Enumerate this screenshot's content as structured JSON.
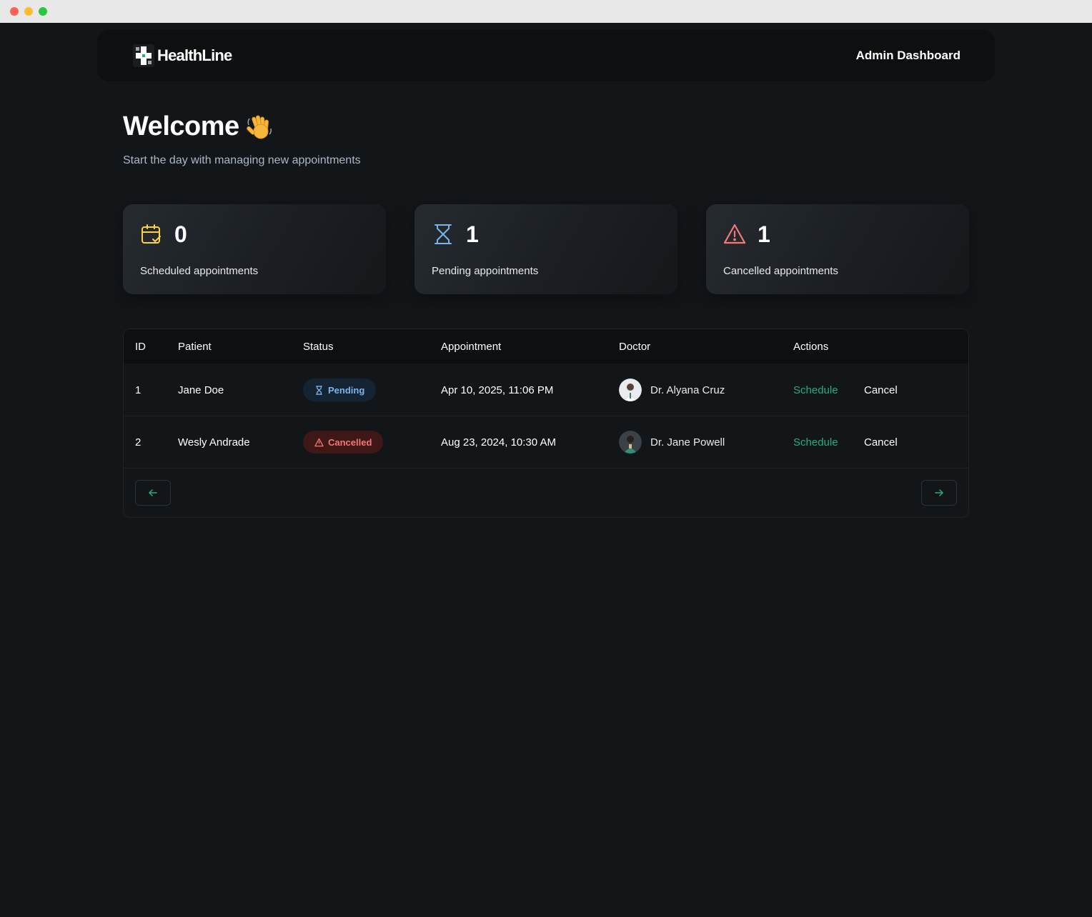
{
  "header": {
    "brand": "HealthLine",
    "title": "Admin Dashboard"
  },
  "welcome": {
    "title": "Welcome",
    "subtitle": "Start the day with managing new appointments"
  },
  "stats": [
    {
      "icon": "calendar-check-icon",
      "count": "0",
      "label": "Scheduled appointments",
      "color": "#ffd147"
    },
    {
      "icon": "hourglass-icon",
      "count": "1",
      "label": "Pending appointments",
      "color": "#79b5ec"
    },
    {
      "icon": "alert-triangle-icon",
      "count": "1",
      "label": "Cancelled appointments",
      "color": "#f37877"
    }
  ],
  "table": {
    "columns": [
      "ID",
      "Patient",
      "Status",
      "Appointment",
      "Doctor",
      "Actions"
    ],
    "rows": [
      {
        "id": "1",
        "patient": "Jane Doe",
        "status": "Pending",
        "appointment": "Apr 10, 2025, 11:06 PM",
        "doctor": "Dr. Alyana Cruz",
        "schedule": "Schedule",
        "cancel": "Cancel"
      },
      {
        "id": "2",
        "patient": "Wesly Andrade",
        "status": "Cancelled",
        "appointment": "Aug 23, 2024, 10:30 AM",
        "doctor": "Dr. Jane Powell",
        "schedule": "Schedule",
        "cancel": "Cancel"
      }
    ]
  },
  "colors": {
    "accent_green": "#24ae7c",
    "pending_blue": "#79b5ec",
    "cancelled_red": "#f37877",
    "scheduled_yellow": "#ffd147"
  }
}
